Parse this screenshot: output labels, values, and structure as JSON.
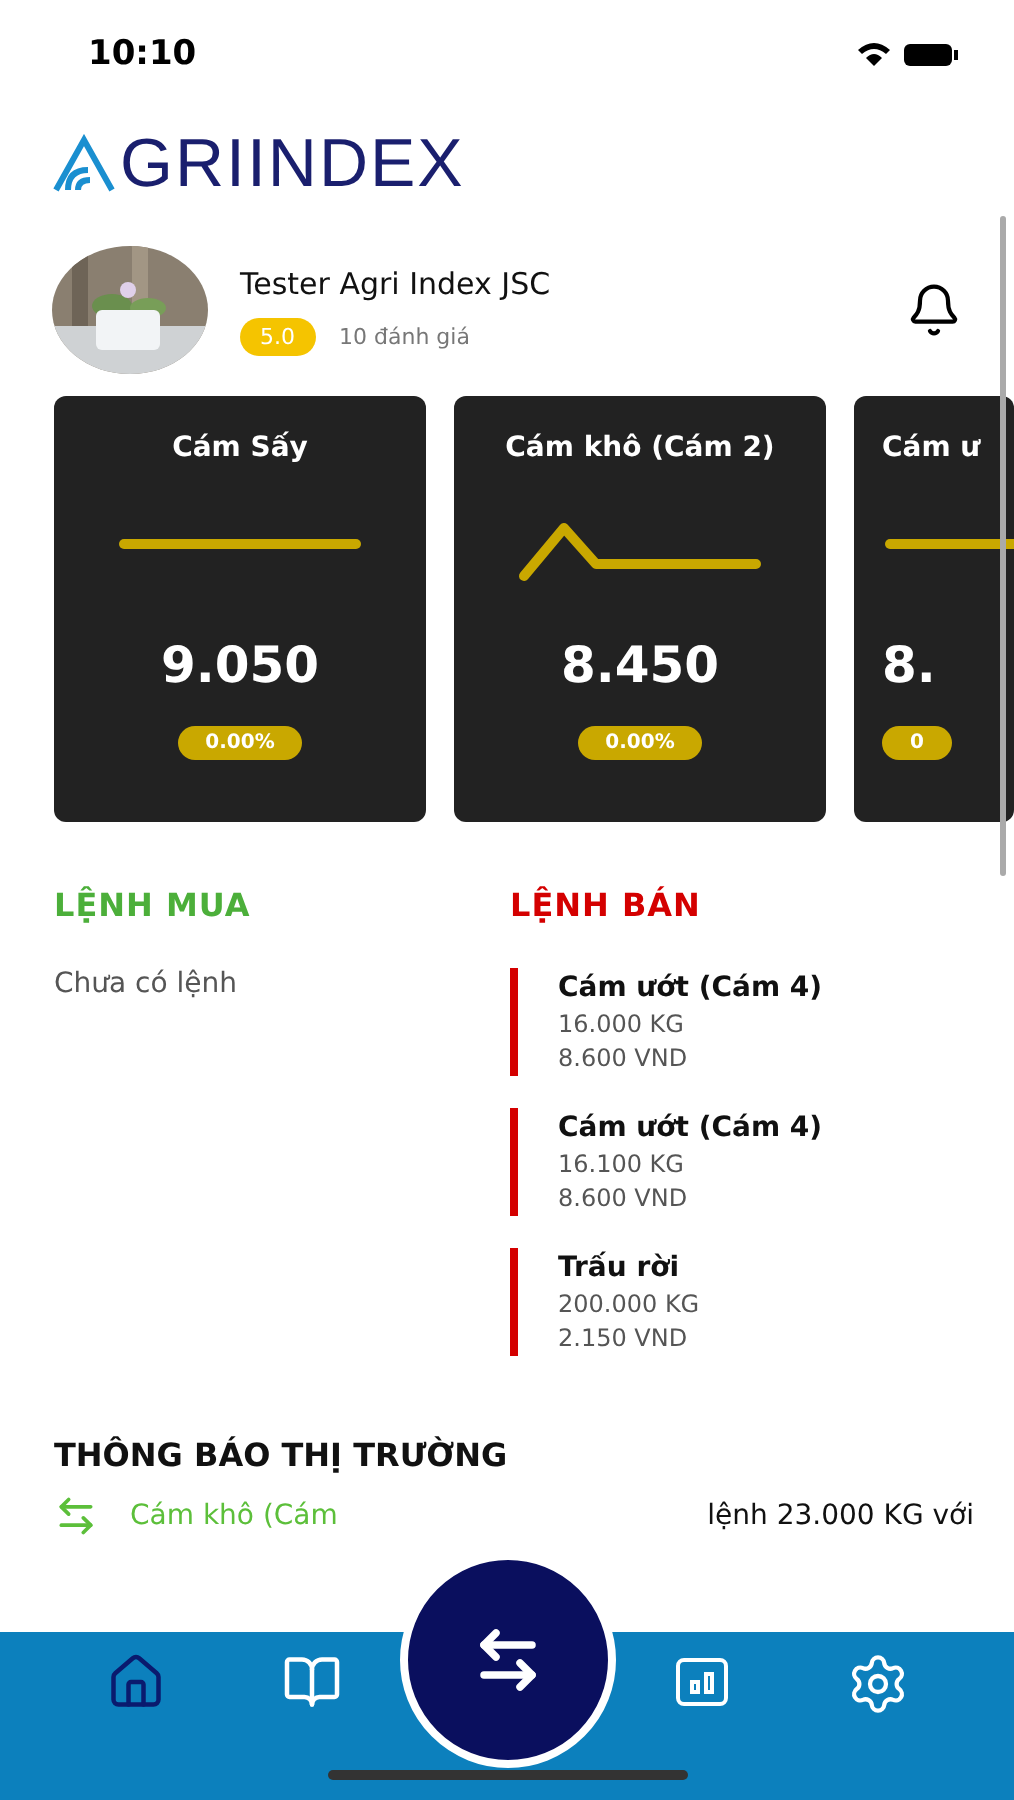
{
  "status_bar": {
    "time": "10:10"
  },
  "logo": {
    "text": "GRIINDEX"
  },
  "profile": {
    "name": "Tester Agri Index JSC",
    "rating": "5.0",
    "reviews": "10 đánh giá"
  },
  "price_cards": [
    {
      "title": "Cám Sấy",
      "price": "9.050",
      "change": "0.00%",
      "kind": "flat"
    },
    {
      "title": "Cám khô (Cám 2)",
      "price": "8.450",
      "change": "0.00%",
      "kind": "peak"
    },
    {
      "title": "Cám ư",
      "price": "8.",
      "change": "0",
      "kind": "flat"
    }
  ],
  "buy_orders": {
    "title": "LỆNH MUA",
    "empty": "Chưa có lệnh"
  },
  "sell_orders": {
    "title": "LỆNH BÁN",
    "items": [
      {
        "product": "Cám ướt (Cám 4)",
        "quantity": "16.000 KG",
        "price": "8.600 VND"
      },
      {
        "product": "Cám ướt (Cám 4)",
        "quantity": "16.100 KG",
        "price": "8.600 VND"
      },
      {
        "product": "Trấu rời",
        "quantity": "200.000 KG",
        "price": "2.150 VND"
      }
    ]
  },
  "market_news": {
    "title": "THÔNG BÁO THỊ TRƯỜNG",
    "product": "Cám khô (Cám",
    "text": "lệnh 23.000 KG với"
  },
  "tab_bar": [
    {
      "kind": "home",
      "selected": true
    },
    {
      "kind": "book",
      "selected": false
    },
    {
      "kind": "exchange",
      "selected": false
    },
    {
      "kind": "chart",
      "selected": false
    },
    {
      "kind": "settings",
      "selected": false
    }
  ]
}
